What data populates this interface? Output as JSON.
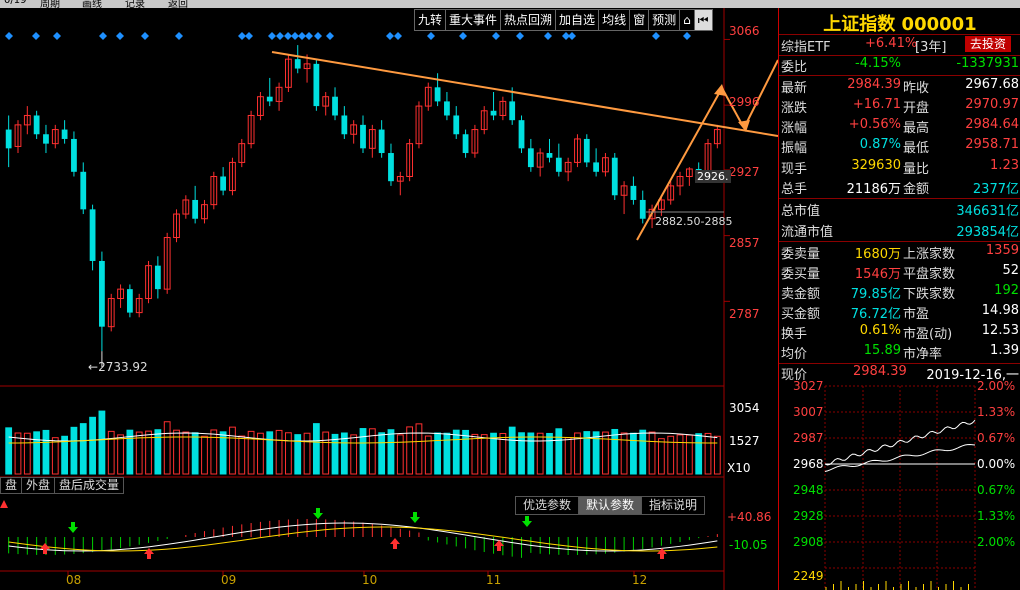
{
  "toolbar": [
    "九转",
    "重大事件",
    "热点回溯",
    "加自选",
    "均线",
    "窗",
    "预测"
  ],
  "toolbar_icons": [
    "home-icon",
    "back-arrow-icon"
  ],
  "tabs": [
    "盘",
    "外盘",
    "盘后成交量"
  ],
  "params": [
    "优选参数",
    "默认参数",
    "指标说明"
  ],
  "axis": {
    "price": [
      "3066",
      "2996",
      "2927",
      "2857",
      "2787"
    ],
    "volume": [
      "3054",
      "1527",
      "X10"
    ],
    "macd": [
      "+40.86",
      "-10.05"
    ],
    "months": [
      "08",
      "09",
      "10",
      "11",
      "12"
    ]
  },
  "annotations": {
    "low": "2733.92",
    "cursor_price": "2926.",
    "range": "2882.50-2885"
  },
  "chart_data": {
    "type": "candlestick",
    "ylim": [
      2700,
      3075
    ],
    "up_color": "#ff3030",
    "down_color": "#00e0e0",
    "candles": [
      [
        2970,
        2985,
        2930,
        2950
      ],
      [
        2952,
        2980,
        2945,
        2975
      ],
      [
        2975,
        2995,
        2965,
        2985
      ],
      [
        2985,
        2990,
        2960,
        2965
      ],
      [
        2965,
        2975,
        2945,
        2955
      ],
      [
        2955,
        2975,
        2950,
        2970
      ],
      [
        2970,
        2980,
        2955,
        2960
      ],
      [
        2960,
        2968,
        2920,
        2925
      ],
      [
        2925,
        2935,
        2880,
        2885
      ],
      [
        2885,
        2890,
        2820,
        2830
      ],
      [
        2830,
        2840,
        2733.92,
        2760
      ],
      [
        2760,
        2795,
        2755,
        2790
      ],
      [
        2790,
        2805,
        2780,
        2800
      ],
      [
        2800,
        2805,
        2770,
        2775
      ],
      [
        2775,
        2795,
        2770,
        2790
      ],
      [
        2790,
        2830,
        2785,
        2825
      ],
      [
        2825,
        2835,
        2790,
        2800
      ],
      [
        2800,
        2860,
        2795,
        2855
      ],
      [
        2855,
        2885,
        2850,
        2880
      ],
      [
        2880,
        2900,
        2875,
        2895
      ],
      [
        2895,
        2910,
        2870,
        2875
      ],
      [
        2875,
        2895,
        2870,
        2890
      ],
      [
        2890,
        2925,
        2885,
        2920
      ],
      [
        2920,
        2930,
        2900,
        2905
      ],
      [
        2905,
        2940,
        2900,
        2935
      ],
      [
        2935,
        2960,
        2930,
        2955
      ],
      [
        2955,
        2990,
        2950,
        2985
      ],
      [
        2985,
        3010,
        2980,
        3005
      ],
      [
        3005,
        3025,
        2995,
        3000
      ],
      [
        3000,
        3020,
        2990,
        3015
      ],
      [
        3015,
        3050,
        3010,
        3045
      ],
      [
        3045,
        3060,
        3030,
        3035
      ],
      [
        3035,
        3050,
        3020,
        3040
      ],
      [
        3040,
        3045,
        2990,
        2995
      ],
      [
        2995,
        3010,
        2985,
        3005
      ],
      [
        3005,
        3015,
        2980,
        2985
      ],
      [
        2985,
        2995,
        2960,
        2965
      ],
      [
        2965,
        2980,
        2955,
        2975
      ],
      [
        2975,
        2985,
        2945,
        2950
      ],
      [
        2950,
        2975,
        2940,
        2970
      ],
      [
        2970,
        2980,
        2940,
        2945
      ],
      [
        2945,
        2955,
        2910,
        2915
      ],
      [
        2915,
        2925,
        2900,
        2920
      ],
      [
        2920,
        2960,
        2915,
        2955
      ],
      [
        2955,
        3000,
        2950,
        2995
      ],
      [
        2995,
        3020,
        2990,
        3015
      ],
      [
        3015,
        3030,
        2995,
        3000
      ],
      [
        3000,
        3010,
        2980,
        2985
      ],
      [
        2985,
        2995,
        2960,
        2965
      ],
      [
        2965,
        2970,
        2940,
        2945
      ],
      [
        2945,
        2975,
        2940,
        2970
      ],
      [
        2970,
        2995,
        2965,
        2990
      ],
      [
        2990,
        3010,
        2980,
        2985
      ],
      [
        2985,
        3005,
        2980,
        3000
      ],
      [
        3000,
        3015,
        2975,
        2980
      ],
      [
        2980,
        2985,
        2945,
        2950
      ],
      [
        2950,
        2960,
        2925,
        2930
      ],
      [
        2930,
        2950,
        2920,
        2945
      ],
      [
        2945,
        2960,
        2935,
        2940
      ],
      [
        2940,
        2955,
        2920,
        2925
      ],
      [
        2925,
        2940,
        2915,
        2935
      ],
      [
        2935,
        2965,
        2930,
        2960
      ],
      [
        2960,
        2965,
        2930,
        2935
      ],
      [
        2935,
        2950,
        2920,
        2925
      ],
      [
        2925,
        2945,
        2920,
        2940
      ],
      [
        2940,
        2945,
        2895,
        2900
      ],
      [
        2900,
        2915,
        2880,
        2910
      ],
      [
        2910,
        2920,
        2890,
        2895
      ],
      [
        2895,
        2905,
        2870,
        2875
      ],
      [
        2875,
        2890,
        2865,
        2885
      ],
      [
        2885,
        2900,
        2878,
        2895
      ],
      [
        2895,
        2915,
        2890,
        2910
      ],
      [
        2910,
        2925,
        2900,
        2920
      ],
      [
        2920,
        2930,
        2910,
        2928
      ],
      [
        2928,
        2935,
        2915,
        2926
      ],
      [
        2926,
        2960,
        2922,
        2955
      ],
      [
        2955,
        2975,
        2950,
        2970
      ]
    ],
    "volume_ylim": [
      0,
      3500
    ]
  },
  "index": {
    "title": "上证指数 000001",
    "etf_label": "综指ETF",
    "etf_change": "+6.41%",
    "etf_suffix": "[3年]",
    "invest_button": "去投资",
    "rows": [
      {
        "l1": "委比",
        "v1": "-4.15%",
        "l2": "",
        "v2": "-1337931"
      },
      {
        "l1": "最新",
        "v1": "2984.39",
        "l2": "昨收",
        "v2": "2967.68"
      },
      {
        "l1": "涨跌",
        "v1": "+16.71",
        "l2": "开盘",
        "v2": "2970.97"
      },
      {
        "l1": "涨幅",
        "v1": "+0.56%",
        "l2": "最高",
        "v2": "2984.64"
      },
      {
        "l1": "振幅",
        "v1": "0.87%",
        "l2": "最低",
        "v2": "2958.71"
      },
      {
        "l1": "现手",
        "v1": "329630",
        "l2": "量比",
        "v2": "1.23"
      },
      {
        "l1": "总手",
        "v1": "21186万",
        "l2": "金额",
        "v2": "2377亿"
      }
    ],
    "market_cap": {
      "l1": "总市值",
      "v1": "346631亿",
      "l2": "流通市值",
      "v2": "293854亿"
    },
    "stats": [
      {
        "l1": "委卖量",
        "v1": "1680万",
        "l2": "上涨家数",
        "v2": "1359"
      },
      {
        "l1": "委买量",
        "v1": "1546万",
        "l2": "平盘家数",
        "v2": "52"
      },
      {
        "l1": "卖金额",
        "v1": "79.85亿",
        "l2": "下跌家数",
        "v2": "192"
      },
      {
        "l1": "买金额",
        "v1": "76.72亿",
        "l2": "市盈",
        "v2": "14.98"
      },
      {
        "l1": "换手",
        "v1": "0.61%",
        "l2": "市盈(动)",
        "v2": "12.53"
      },
      {
        "l1": "均价",
        "v1": "15.89",
        "l2": "市净率",
        "v2": "1.39"
      }
    ],
    "current": {
      "label": "现价",
      "value": "2984.39",
      "date": "2019-12-16,一"
    }
  },
  "mini": {
    "left_labels": [
      "3027",
      "3007",
      "2987",
      "2968",
      "2948",
      "2928",
      "2908",
      "2249"
    ],
    "right_labels": [
      "2.00%",
      "1.33%",
      "0.67%",
      "0.00%",
      "0.67%",
      "1.33%",
      "2.00%"
    ]
  }
}
